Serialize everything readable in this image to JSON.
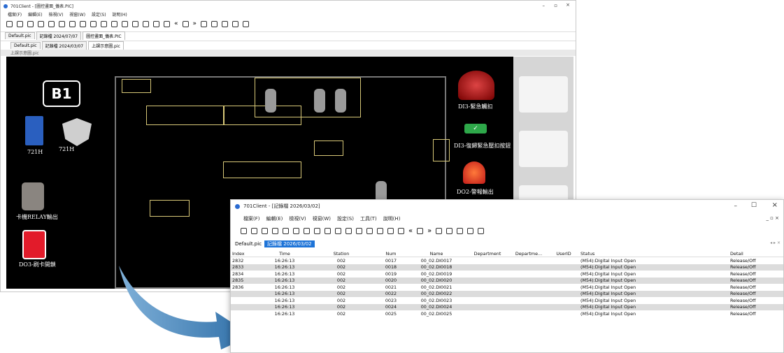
{
  "back": {
    "title": "701Client - [圖控畫面_儀表.PIC]",
    "menu": [
      "檔案(F)",
      "編輯(E)",
      "檢視(V)",
      "視窗(W)",
      "設定(S)",
      "說明(H)"
    ],
    "tabs_row1": [
      "Default.pic",
      "記錄檔 2024/07/07",
      "圖控畫面_儀表.PIC"
    ],
    "tabs_row2": [
      "Default.pic",
      "記錄檔 2024/03/07",
      "上課示意圖.pic"
    ],
    "panel_title": "上課示意圖.pic",
    "floor": "B1",
    "labels": {
      "dev1": "721H",
      "dev2": "721H",
      "relay": "卡機RELAY輸出",
      "door": "DO3-刷卡開鎖",
      "di3_alarm": "DI3-緊急觸扣",
      "di3_reset": "DI3-復歸緊急壓扣按鈕",
      "do2": "DO2-警報輸出"
    }
  },
  "front": {
    "title": "701Client - [記錄檔 2026/03/02]",
    "menu": [
      "檔案(F)",
      "編輯(E)",
      "檢視(V)",
      "視窗(W)",
      "設定(S)",
      "工具(T)",
      "說明(H)"
    ],
    "tabs": [
      "Default.pic",
      "記錄檔 2026/03/02"
    ],
    "columns": [
      "Index",
      "Time",
      "Station",
      "Num",
      "Name",
      "Department",
      "Departme...",
      "UserID",
      "Status",
      "Detail"
    ],
    "rows": [
      [
        "2832",
        "16:26:13",
        "002",
        "0017",
        "00_02.DI0017",
        "",
        "",
        "",
        "(M54):Digital Input Open",
        "Release/Off"
      ],
      [
        "2833",
        "16:26:13",
        "002",
        "0018",
        "00_02.DI0018",
        "",
        "",
        "",
        "(M54):Digital Input Open",
        "Release/Off"
      ],
      [
        "2834",
        "16:26:13",
        "002",
        "0019",
        "00_02.DI0019",
        "",
        "",
        "",
        "(M54):Digital Input Open",
        "Release/Off"
      ],
      [
        "2835",
        "16:26:13",
        "002",
        "0020",
        "00_02.DI0020",
        "",
        "",
        "",
        "(M54):Digital Input Open",
        "Release/Off"
      ],
      [
        "2836",
        "16:26:13",
        "002",
        "0021",
        "00_02.DI0021",
        "",
        "",
        "",
        "(M54):Digital Input Open",
        "Release/Off"
      ],
      [
        "",
        "16:26:13",
        "002",
        "0022",
        "00_02.DI0022",
        "",
        "",
        "",
        "(M54):Digital Input Open",
        "Release/Off"
      ],
      [
        "",
        "16:26:13",
        "002",
        "0023",
        "00_02.DI0023",
        "",
        "",
        "",
        "(M54):Digital Input Open",
        "Release/Off"
      ],
      [
        "",
        "16:26:13",
        "002",
        "0024",
        "00_02.DI0024",
        "",
        "",
        "",
        "(M54):Digital Input Open",
        "Release/Off"
      ],
      [
        "",
        "16:26:13",
        "002",
        "0025",
        "00_02.DI0025",
        "",
        "",
        "",
        "(M54):Digital Input Open",
        "Release/Off"
      ]
    ]
  }
}
